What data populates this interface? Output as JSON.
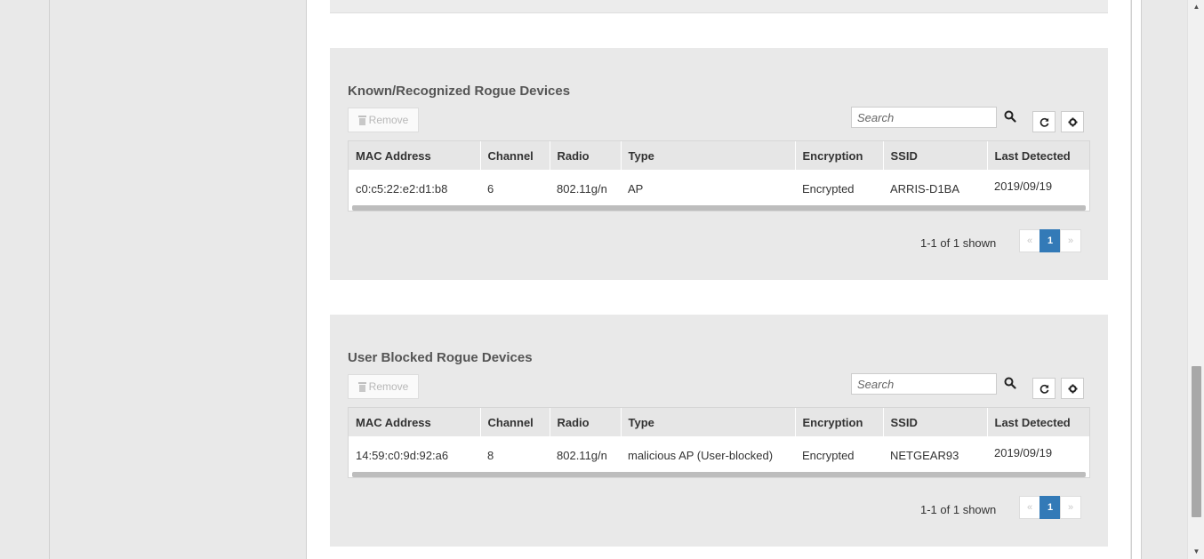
{
  "colors": {
    "page_bg": "#e9e9e9",
    "card_bg": "#e9e9e9",
    "pagination_active": "#337ab7"
  },
  "sections": [
    {
      "title": "Known/Recognized Rogue Devices",
      "remove_label": "Remove",
      "search_placeholder": "Search",
      "columns": [
        "MAC Address",
        "Channel",
        "Radio",
        "Type",
        "Encryption",
        "SSID",
        "Last Detected"
      ],
      "rows": [
        {
          "mac": "c0:c5:22:e2:d1:b8",
          "channel": "6",
          "radio": "802.11g/n",
          "type": "AP",
          "encryption": "Encrypted",
          "ssid": "ARRIS-D1BA",
          "last_detected": "2019/09/19"
        }
      ],
      "shown_text": "1-1 of 1 shown",
      "pagination": {
        "prev": "«",
        "current": "1",
        "next": "»"
      }
    },
    {
      "title": "User Blocked Rogue Devices",
      "remove_label": "Remove",
      "search_placeholder": "Search",
      "columns": [
        "MAC Address",
        "Channel",
        "Radio",
        "Type",
        "Encryption",
        "SSID",
        "Last Detected"
      ],
      "rows": [
        {
          "mac": "14:59:c0:9d:92:a6",
          "channel": "8",
          "radio": "802.11g/n",
          "type": "malicious AP (User-blocked)",
          "encryption": "Encrypted",
          "ssid": "NETGEAR93",
          "last_detected": "2019/09/19"
        }
      ],
      "shown_text": "1-1 of 1 shown",
      "pagination": {
        "prev": "«",
        "current": "1",
        "next": "»"
      }
    }
  ],
  "icons": {
    "remove": "trash-icon",
    "search": "search-icon",
    "refresh": "refresh-icon",
    "settings": "gear-icon"
  }
}
